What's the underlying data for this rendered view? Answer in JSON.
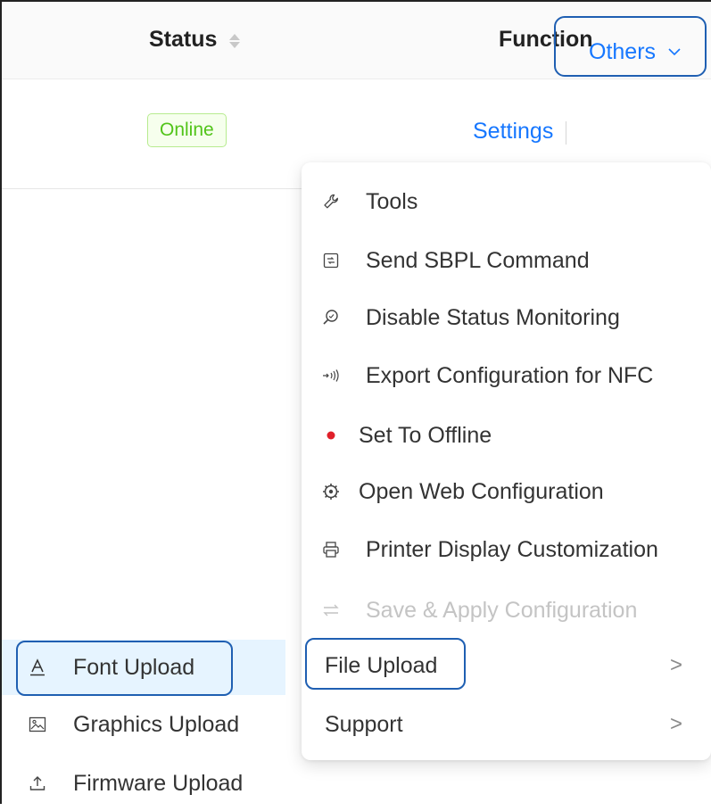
{
  "table": {
    "headers": {
      "status": "Status",
      "function": "Function"
    },
    "row": {
      "status_badge": "Online",
      "actions": {
        "settings": "Settings",
        "others": "Others"
      }
    }
  },
  "dropdown": {
    "items": [
      {
        "label": "Tools",
        "icon": "wrench-icon"
      },
      {
        "label": "Send SBPL Command",
        "icon": "command-icon"
      },
      {
        "label": "Disable Status Monitoring",
        "icon": "monitor-search-icon"
      },
      {
        "label": "Export Configuration for NFC",
        "icon": "nfc-icon"
      },
      {
        "label": "Set To Offline",
        "icon": "red-dot-icon"
      },
      {
        "label": "Open Web Configuration",
        "icon": "web-icon"
      },
      {
        "label": "Printer Display Customization",
        "icon": "printer-icon"
      },
      {
        "label": "Save & Apply Configuration",
        "icon": "swap-icon",
        "disabled": true
      },
      {
        "label": "File Upload",
        "submenu": true
      },
      {
        "label": "Support",
        "submenu": true
      }
    ],
    "submenu_arrow": ">"
  },
  "submenu": {
    "items": [
      {
        "label": "Font Upload",
        "icon": "font-icon",
        "active": true
      },
      {
        "label": "Graphics Upload",
        "icon": "image-icon"
      },
      {
        "label": "Firmware Upload",
        "icon": "upload-icon"
      }
    ]
  },
  "colors": {
    "link": "#1677ff",
    "online_text": "#52c41a",
    "highlight_border": "#1f5fb2",
    "offline_dot": "#e0202a",
    "active_bg": "#e6f4ff"
  }
}
